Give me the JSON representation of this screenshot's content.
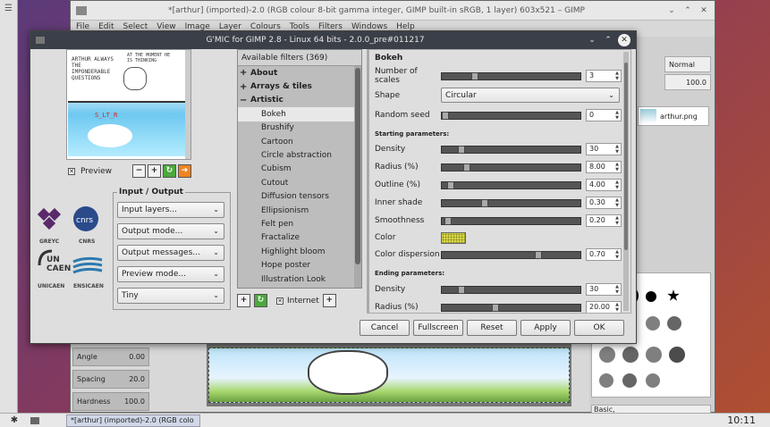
{
  "gimp": {
    "title": "*[arthur] (imported)-2.0 (RGB colour 8-bit gamma integer, GIMP built-in sRGB, 1 layer) 603x521 – GIMP",
    "menu": [
      "File",
      "Edit",
      "Select",
      "View",
      "Image",
      "Layer",
      "Colours",
      "Tools",
      "Filters",
      "Windows",
      "Help"
    ],
    "tool_options": [
      {
        "label": "Angle",
        "value": "0.00"
      },
      {
        "label": "Spacing",
        "value": "20.0"
      },
      {
        "label": "Hardness",
        "value": "100.0"
      }
    ],
    "dock": {
      "mode": "Normal",
      "opacity": "100.0",
      "layer_name": "arthur.png",
      "brush_preset": "Basic,"
    }
  },
  "taskbar": {
    "task_label": "*[arthur] (imported)-2.0 (RGB colo",
    "clock": "10:11"
  },
  "gmic": {
    "title": "G'MIC for GIMP 2.8 - Linux 64 bits - 2.0.0_pre#011217",
    "preview_label": "Preview",
    "comic_text_1": "ARTHUR ALWAYS THE IMPONDERABLE QUESTIONS",
    "comic_text_2": "AT THE MOMENT HE IS THINKING",
    "comic_text_red": "S_LT_R",
    "logos": [
      "GREYC",
      "CNRS",
      "UNICAEN",
      "ENSICAEN"
    ],
    "io_title": "Input / Output",
    "io_combos": [
      "Input layers...",
      "Output mode...",
      "Output messages...",
      "Preview mode...",
      "Tiny"
    ],
    "filters_header": "Available filters (369)",
    "categories": [
      {
        "label": "About",
        "expanded": false
      },
      {
        "label": "Arrays & tiles",
        "expanded": false
      },
      {
        "label": "Artistic",
        "expanded": true
      }
    ],
    "artistic_filters": [
      "Bokeh",
      "Brushify",
      "Cartoon",
      "Circle abstraction",
      "Cubism",
      "Cutout",
      "Diffusion tensors",
      "Ellipsionism",
      "Felt pen",
      "Fractalize",
      "Highlight bloom",
      "Hope poster",
      "Illustration Look"
    ],
    "selected_filter": "Bokeh",
    "internet_label": "Internet",
    "params_title": "Bokeh",
    "params": {
      "number_of_scales": {
        "label": "Number of scales",
        "value": "3",
        "fraction": 0.22
      },
      "shape": {
        "label": "Shape",
        "value": "Circular"
      },
      "random_seed": {
        "label": "Random seed",
        "value": "0",
        "fraction": 0.0
      },
      "starting_section": "Starting parameters:",
      "start_density": {
        "label": "Density",
        "value": "30",
        "fraction": 0.12
      },
      "start_radius": {
        "label": "Radius (%)",
        "value": "8.00",
        "fraction": 0.16
      },
      "start_outline": {
        "label": "Outline (%)",
        "value": "4.00",
        "fraction": 0.04
      },
      "start_inner_shade": {
        "label": "Inner shade",
        "value": "0.30",
        "fraction": 0.3
      },
      "start_smoothness": {
        "label": "Smoothness",
        "value": "0.20",
        "fraction": 0.02
      },
      "color": {
        "label": "Color",
        "value": "#d8d848"
      },
      "color_dispersion": {
        "label": "Color dispersion",
        "value": "0.70",
        "fraction": 0.7
      },
      "ending_section": "Ending parameters:",
      "end_density": {
        "label": "Density",
        "value": "30",
        "fraction": 0.12
      },
      "end_radius": {
        "label": "Radius (%)",
        "value": "20.00",
        "fraction": 0.38
      }
    },
    "buttons": {
      "cancel": "Cancel",
      "fullscreen": "Fullscreen",
      "reset": "Reset",
      "apply": "Apply",
      "ok": "OK"
    }
  }
}
